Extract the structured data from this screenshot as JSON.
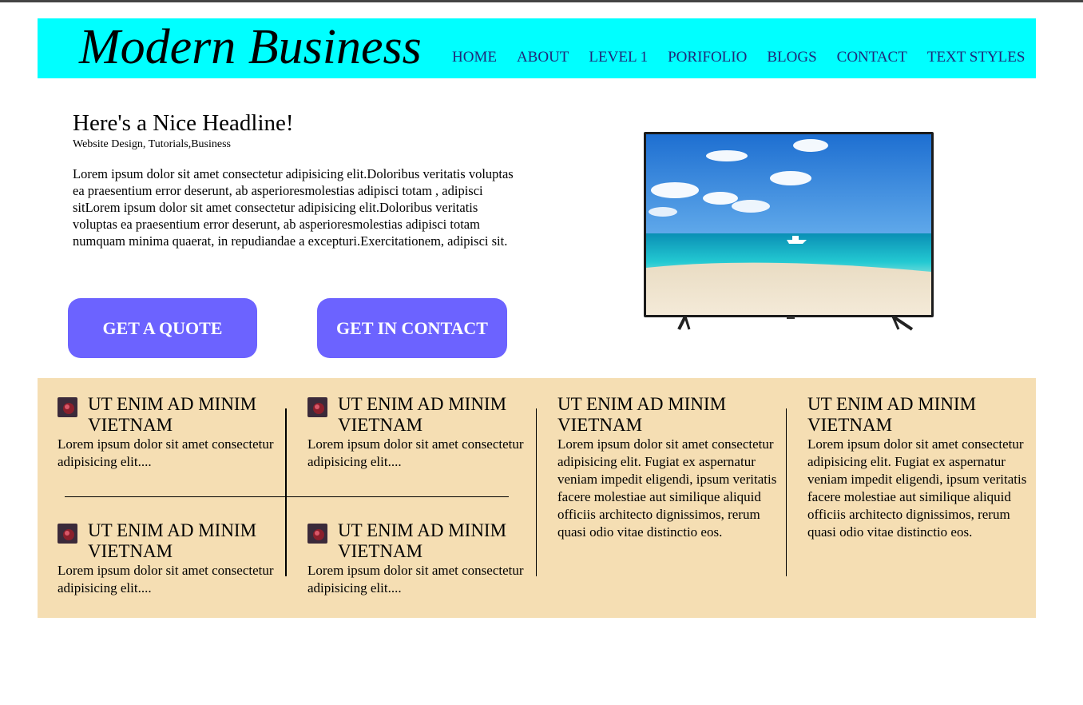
{
  "header": {
    "brand": "Modern Business",
    "nav": [
      "HOME",
      "ABOUT",
      "LEVEL 1",
      "PORIFOLIO",
      "BLOGS",
      "CONTACT",
      "TEXT STYLES"
    ]
  },
  "hero": {
    "headline": "Here's a Nice Headline!",
    "subline": "Website Design, Tutorials,Business",
    "body": "Lorem ipsum dolor sit amet consectetur adipisicing elit.Doloribus veritatis voluptas ea praesentium error deserunt, ab asperioresmolestias adipisci totam , adipisci sitLorem ipsum dolor sit amet consectetur adipisicing elit.Doloribus veritatis voluptas ea praesentium error deserunt, ab asperioresmolestias adipisci totam numquam minima quaerat, in repudiandae a excepturi.Exercitationem, adipisci sit.",
    "quote_button": "GET A QUOTE",
    "contact_button": "GET IN CONTACT"
  },
  "features": {
    "small": [
      {
        "title": "UT ENIM AD MINIM VIETNAM",
        "text": "Lorem ipsum dolor sit amet consectetur adipisicing elit...."
      },
      {
        "title": "UT ENIM AD MINIM VIETNAM",
        "text": "Lorem ipsum dolor sit amet consectetur adipisicing elit...."
      },
      {
        "title": "UT ENIM AD MINIM VIETNAM",
        "text": "Lorem ipsum dolor sit amet consectetur adipisicing elit...."
      },
      {
        "title": "UT ENIM AD MINIM VIETNAM",
        "text": "Lorem ipsum dolor sit amet consectetur adipisicing elit...."
      }
    ],
    "large": [
      {
        "title": "UT ENIM AD MINIM VIETNAM",
        "text": "Lorem ipsum dolor sit amet consectetur adipisicing elit. Fugiat ex aspernatur veniam impedit eligendi, ipsum veritatis facere molestiae aut similique aliquid officiis architecto dignissimos, rerum quasi odio vitae distinctio eos."
      },
      {
        "title": "UT ENIM AD MINIM VIETNAM",
        "text": "Lorem ipsum dolor sit amet consectetur adipisicing elit. Fugiat ex aspernatur veniam impedit eligendi, ipsum veritatis facere molestiae aut similique aliquid officiis architecto dignissimos, rerum quasi odio vitae distinctio eos."
      }
    ]
  },
  "colors": {
    "header_bg": "#00ffff",
    "button_bg": "#6c63ff",
    "features_bg": "#f5deb3"
  }
}
